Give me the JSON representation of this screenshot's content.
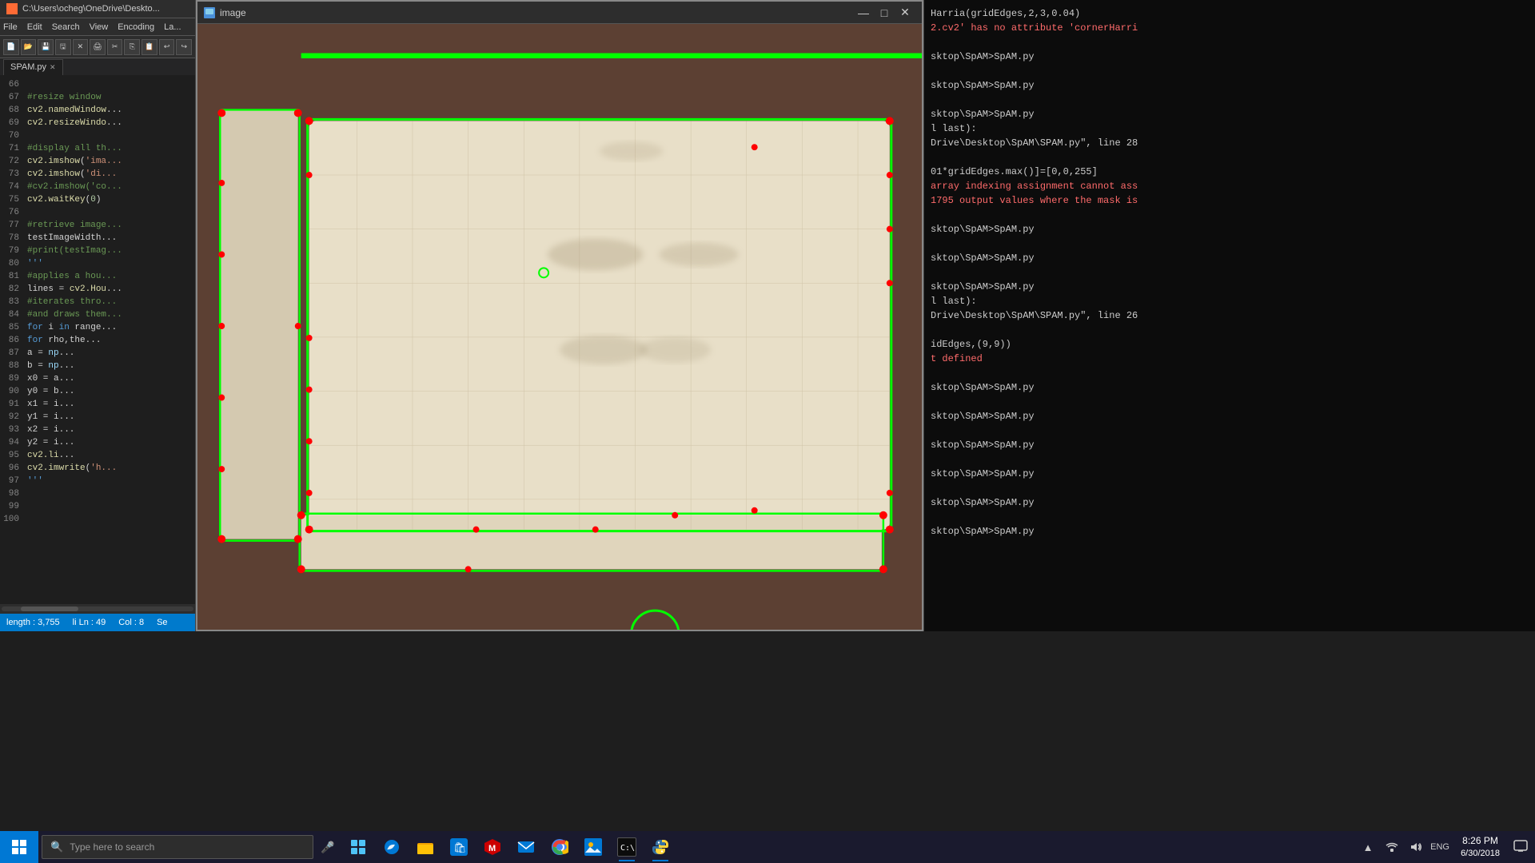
{
  "window": {
    "title": "C:\\Users\\ocheg\\OneDrive\\Deskto...",
    "image_window_title": "image"
  },
  "editor": {
    "tab_label": "SPAM.py",
    "menu_items": [
      "File",
      "Edit",
      "Search",
      "View",
      "Encoding",
      "La..."
    ],
    "statusbar": {
      "length": "length : 3,755",
      "position": "li Ln : 49",
      "col": "Col : 8",
      "se": "Se"
    },
    "lines": [
      {
        "num": "66",
        "code": ""
      },
      {
        "num": "67",
        "code": "    #resize window",
        "type": "comment"
      },
      {
        "num": "68",
        "code": "    cv2.namedWindow...",
        "type": "plain"
      },
      {
        "num": "69",
        "code": "    cv2.resizeWindo...",
        "type": "plain"
      },
      {
        "num": "70",
        "code": ""
      },
      {
        "num": "71",
        "code": "    #display all th...",
        "type": "comment"
      },
      {
        "num": "72",
        "code": "    cv2.imshow('ima...",
        "type": "plain"
      },
      {
        "num": "73",
        "code": "    cv2.imshow('di...",
        "type": "plain"
      },
      {
        "num": "74",
        "code": "    #cv2.imshow('co...",
        "type": "comment"
      },
      {
        "num": "75",
        "code": "    cv2.waitKey(0)",
        "type": "plain"
      },
      {
        "num": "76",
        "code": ""
      },
      {
        "num": "77",
        "code": "    #retrieve image...",
        "type": "comment"
      },
      {
        "num": "78",
        "code": "    testImageWidth...",
        "type": "plain"
      },
      {
        "num": "79",
        "code": "    #print(testImag...",
        "type": "comment"
      },
      {
        "num": "80",
        "code": "'''",
        "type": "plain"
      },
      {
        "num": "81",
        "code": "    #applies a hou...",
        "type": "comment"
      },
      {
        "num": "82",
        "code": "    lines = cv2.Hou...",
        "type": "plain"
      },
      {
        "num": "83",
        "code": "    #iterates thro...",
        "type": "comment"
      },
      {
        "num": "84",
        "code": "    #and draws them...",
        "type": "comment"
      },
      {
        "num": "85",
        "code": "    for i in range...",
        "type": "plain"
      },
      {
        "num": "86",
        "code": "        for rho,the...",
        "type": "plain"
      },
      {
        "num": "87",
        "code": "            a = np...",
        "type": "plain"
      },
      {
        "num": "88",
        "code": "            b = np...",
        "type": "plain"
      },
      {
        "num": "89",
        "code": "            x0 = a...",
        "type": "plain"
      },
      {
        "num": "90",
        "code": "            y0 = b...",
        "type": "plain"
      },
      {
        "num": "91",
        "code": "            x1 = i...",
        "type": "plain"
      },
      {
        "num": "92",
        "code": "            y1 = i...",
        "type": "plain"
      },
      {
        "num": "93",
        "code": "            x2 = i...",
        "type": "plain"
      },
      {
        "num": "94",
        "code": "            y2 = i...",
        "type": "plain"
      },
      {
        "num": "95",
        "code": "            cv2.li...",
        "type": "plain"
      },
      {
        "num": "96",
        "code": "    cv2.imwrite('h...",
        "type": "plain"
      },
      {
        "num": "97",
        "code": "'''",
        "type": "plain"
      },
      {
        "num": "98",
        "code": ""
      },
      {
        "num": "99",
        "code": ""
      },
      {
        "num": "100",
        "code": ""
      }
    ]
  },
  "terminal": {
    "lines": [
      "Harria(gridEdges,2,3,0.04)",
      "2.cv2' has no attribute 'cornerHarri",
      "",
      "sktop\\SpAM>SpAM.py",
      "",
      "sktop\\SpAM>SpAM.py",
      "",
      "sktop\\SpAM>SpAM.py",
      "l last):",
      "Drive\\Desktop\\SpAM\\SPAM.py\", line 28",
      "",
      "01*gridEdges.max()]=[0,0,255]",
      "array indexing assignment cannot ass",
      "1795 output values where the mask is",
      "",
      "sktop\\SpAM>SpAM.py",
      "",
      "sktop\\SpAM>SpAM.py",
      "",
      "sktop\\SpAM>SpAM.py",
      "l last):",
      "Drive\\Desktop\\SpAM\\SPAM.py\", line 26",
      "",
      "idEdges,(9,9))",
      "t defined",
      "",
      "sktop\\SpAM>SpAM.py",
      "",
      "sktop\\SpAM>SpAM.py",
      "",
      "sktop\\SpAM>SpAM.py",
      "",
      "sktop\\SpAM>SpAM.py",
      "",
      "sktop\\SpAM>SpAM.py",
      "",
      "sktop\\SpAM>SpAM.py",
      "",
      "sktop\\SpAM>SpAM.py"
    ]
  },
  "taskbar": {
    "search_placeholder": "Type here to search",
    "apps": [
      {
        "name": "start",
        "label": "Start"
      },
      {
        "name": "search",
        "label": "Search"
      },
      {
        "name": "task-view",
        "label": "Task View"
      },
      {
        "name": "edge",
        "label": "Microsoft Edge"
      },
      {
        "name": "file-explorer",
        "label": "File Explorer"
      },
      {
        "name": "store",
        "label": "Microsoft Store"
      },
      {
        "name": "mcafee",
        "label": "McAfee"
      },
      {
        "name": "mail",
        "label": "Mail"
      },
      {
        "name": "chrome",
        "label": "Google Chrome"
      },
      {
        "name": "photos",
        "label": "Photos"
      },
      {
        "name": "cmd",
        "label": "Command Prompt"
      },
      {
        "name": "python",
        "label": "Python"
      }
    ],
    "clock": {
      "time": "8:26 PM",
      "date": "6/30/2018"
    },
    "sys_icons": [
      "chevron-up",
      "network",
      "speakers",
      "keyboard",
      "notifications"
    ]
  }
}
